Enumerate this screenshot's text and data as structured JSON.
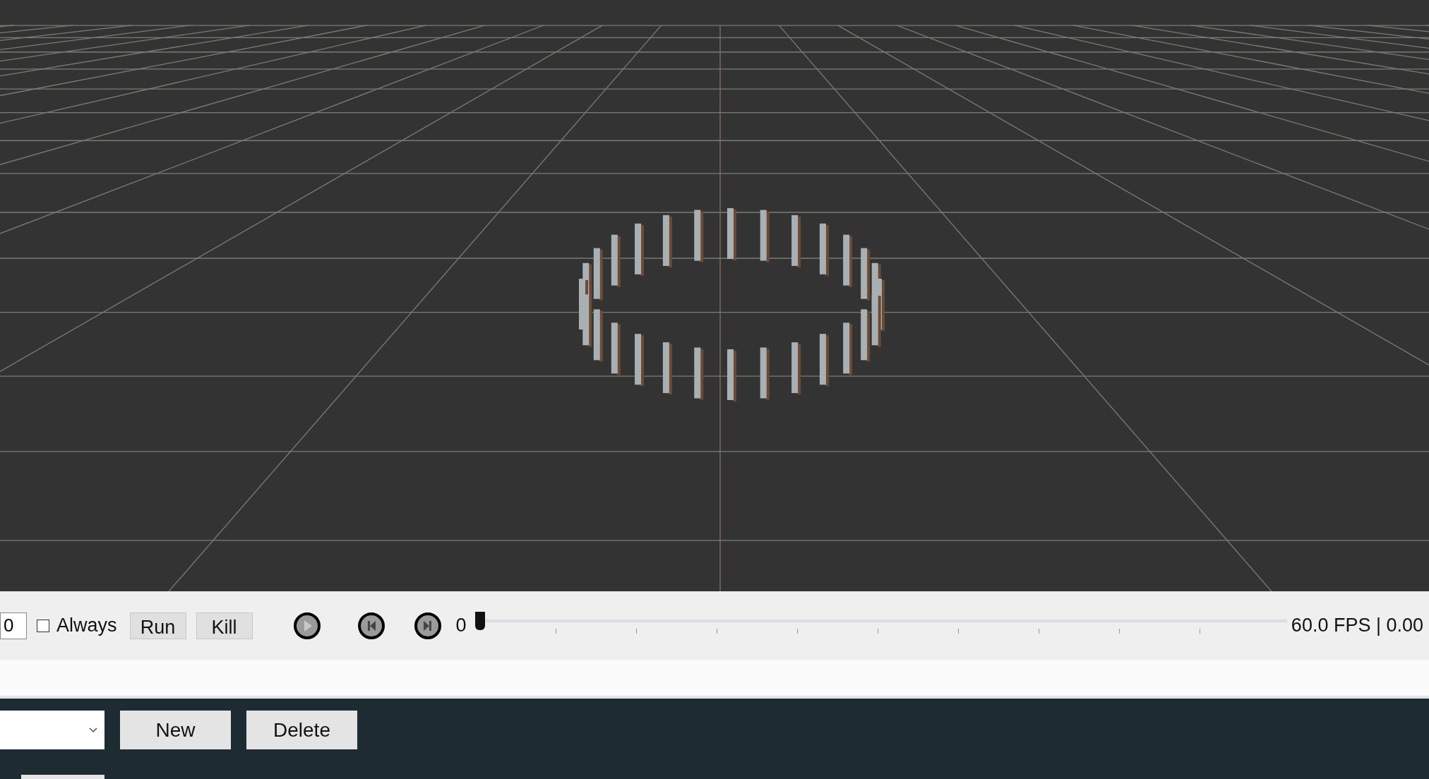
{
  "toolbar": {
    "frame_field": {
      "value": "0"
    },
    "always": {
      "label": "Always",
      "checked": false
    },
    "buttons": [
      "Run",
      "Kill"
    ],
    "frame_number": "0",
    "timeline": {
      "level": 0
    },
    "fps": "60.0 FPS | 0.00"
  },
  "bottom_panel": {
    "dropdown": {
      "expanded": false
    },
    "buttons": [
      "New",
      "Delete"
    ]
  }
}
